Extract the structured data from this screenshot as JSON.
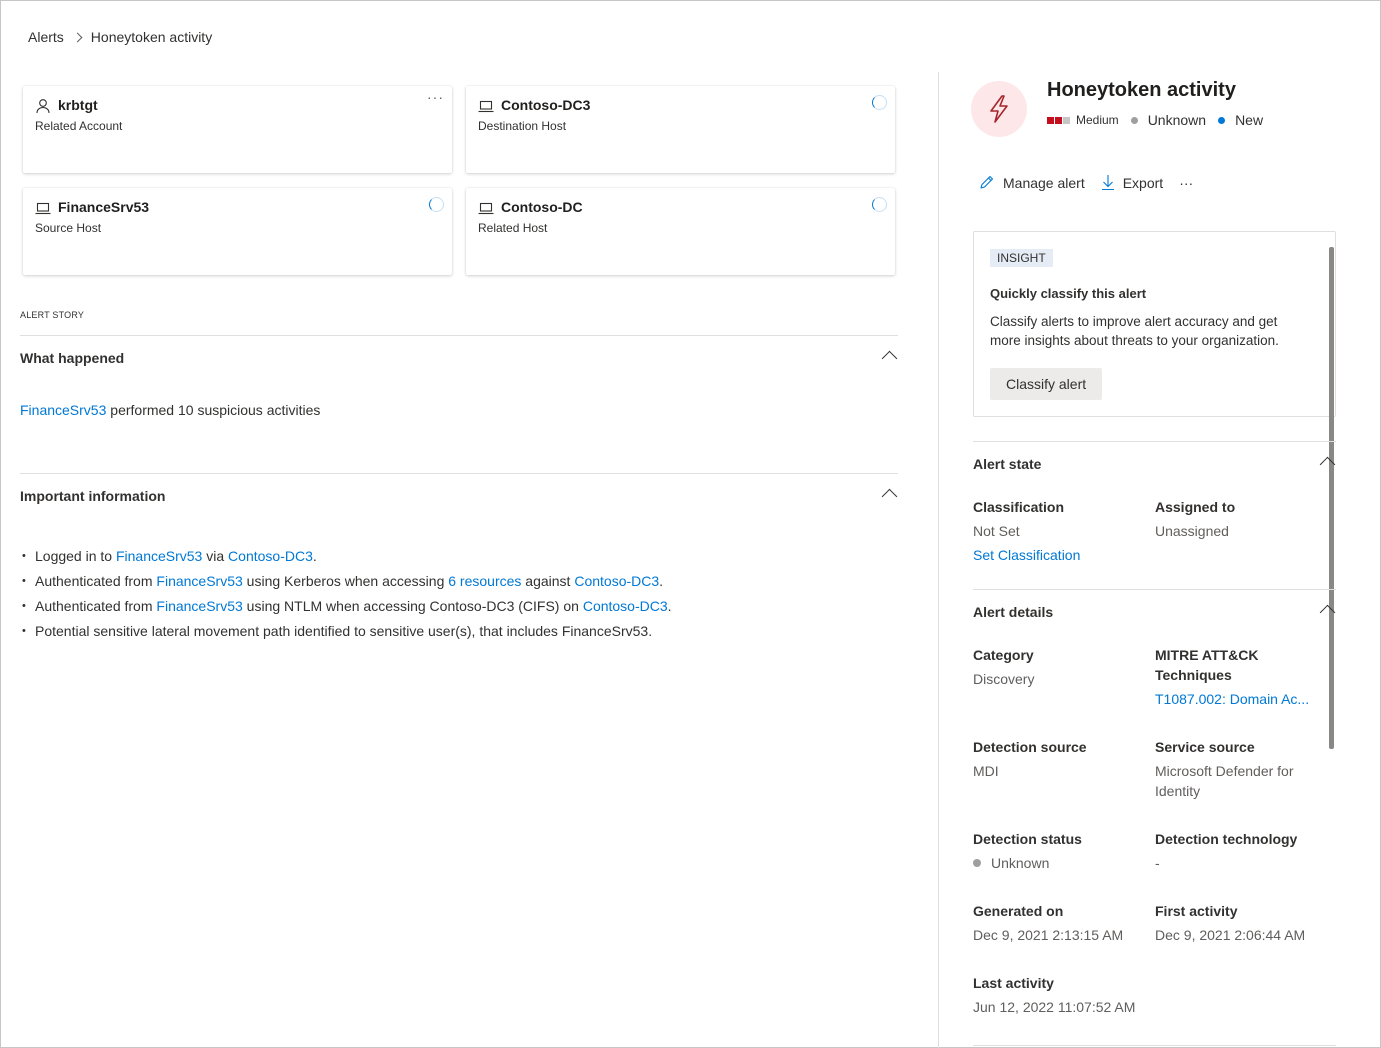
{
  "breadcrumb": {
    "root": "Alerts",
    "current": "Honeytoken activity"
  },
  "entities": [
    {
      "name": "krbtgt",
      "role": "Related Account",
      "icon": "person-icon",
      "action": "more"
    },
    {
      "name": "Contoso-DC3",
      "role": "Destination Host",
      "icon": "laptop-icon",
      "action": "loading"
    },
    {
      "name": "FinanceSrv53",
      "role": "Source Host",
      "icon": "laptop-icon",
      "action": "loading"
    },
    {
      "name": "Contoso-DC",
      "role": "Related Host",
      "icon": "laptop-icon",
      "action": "loading"
    }
  ],
  "story": {
    "label": "ALERT STORY",
    "what_happened": {
      "title": "What happened",
      "link": "FinanceSrv53",
      "text": "performed 10 suspicious activities"
    },
    "important": {
      "title": "Important information",
      "items": [
        [
          {
            "t": "Logged in to "
          },
          {
            "l": "FinanceSrv53"
          },
          {
            "t": " via "
          },
          {
            "l": "Contoso-DC3"
          },
          {
            "t": "."
          }
        ],
        [
          {
            "t": "Authenticated from "
          },
          {
            "l": "FinanceSrv53"
          },
          {
            "t": " using Kerberos when accessing "
          },
          {
            "l": "6 resources"
          },
          {
            "t": " against "
          },
          {
            "l": "Contoso-DC3"
          },
          {
            "t": "."
          }
        ],
        [
          {
            "t": "Authenticated from "
          },
          {
            "l": "FinanceSrv53"
          },
          {
            "t": " using NTLM when accessing Contoso-DC3 (CIFS) on "
          },
          {
            "l": "Contoso-DC3"
          },
          {
            "t": "."
          }
        ],
        [
          {
            "t": "Potential sensitive lateral movement path identified to sensitive user(s), that includes FinanceSrv53."
          }
        ]
      ]
    }
  },
  "alert": {
    "title": "Honeytoken activity",
    "severity": "Medium",
    "status": "Unknown",
    "state": "New",
    "colors": {
      "severity": "#c50f1f",
      "severity_off": "#c8c6c4",
      "status": "#a19f9d",
      "state": "#0078d4",
      "link": "#0078d4"
    }
  },
  "actions": {
    "manage": "Manage alert",
    "export": "Export",
    "more": "···"
  },
  "insight": {
    "badge": "INSIGHT",
    "title": "Quickly classify this alert",
    "body": "Classify alerts to improve alert accuracy and get more insights about threats to your organization.",
    "button": "Classify alert"
  },
  "alert_state": {
    "title": "Alert state",
    "classification_label": "Classification",
    "classification_value": "Not Set",
    "set_link": "Set Classification",
    "assigned_label": "Assigned to",
    "assigned_value": "Unassigned"
  },
  "alert_details": {
    "title": "Alert details",
    "category_label": "Category",
    "category_value": "Discovery",
    "mitre_label_1": "MITRE ATT&CK",
    "mitre_label_2": "Techniques",
    "mitre_value": "T1087.002: Domain Ac...",
    "detection_source_label": "Detection source",
    "detection_source_value": "MDI",
    "service_source_label": "Service source",
    "service_source_value_1": "Microsoft Defender for",
    "service_source_value_2": "Identity",
    "detection_status_label": "Detection status",
    "detection_status_value": "Unknown",
    "detection_tech_label": "Detection technology",
    "detection_tech_value": "-",
    "generated_label": "Generated on",
    "generated_value": "Dec 9, 2021 2:13:15 AM",
    "first_label": "First activity",
    "first_value": "Dec 9, 2021 2:06:44 AM",
    "last_label": "Last activity",
    "last_value": "Jun 12, 2022 11:07:52 AM"
  }
}
